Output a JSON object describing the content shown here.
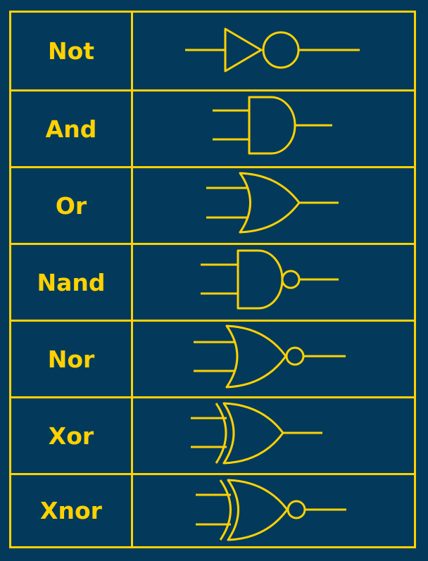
{
  "table": {
    "accent_color": "#ffd100",
    "background_color": "#033a5c",
    "rows": [
      {
        "label": "Not",
        "symbol": "not-gate-icon"
      },
      {
        "label": "And",
        "symbol": "and-gate-icon"
      },
      {
        "label": "Or",
        "symbol": "or-gate-icon"
      },
      {
        "label": "Nand",
        "symbol": "nand-gate-icon"
      },
      {
        "label": "Nor",
        "symbol": "nor-gate-icon"
      },
      {
        "label": "Xor",
        "symbol": "xor-gate-icon"
      },
      {
        "label": "Xnor",
        "symbol": "xnor-gate-icon"
      }
    ]
  }
}
